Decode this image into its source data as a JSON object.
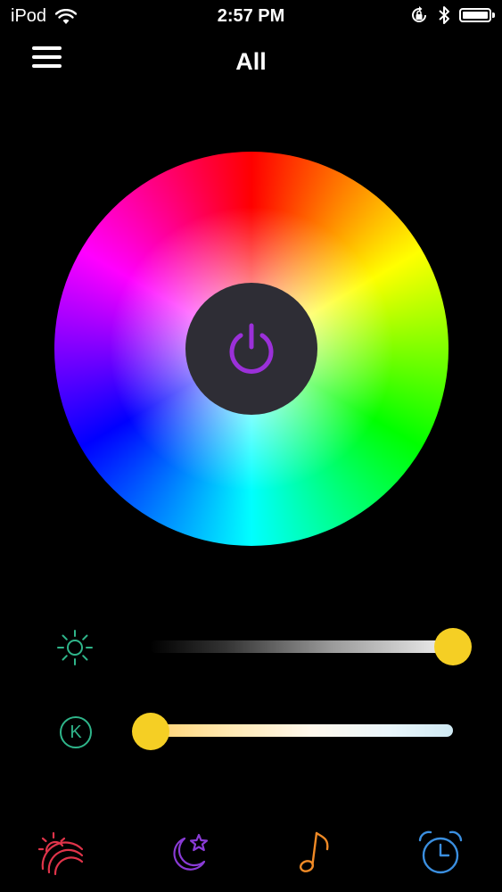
{
  "status_bar": {
    "carrier": "iPod",
    "time": "2:57 PM",
    "icons": [
      "wifi-icon",
      "rotation-lock-icon",
      "bluetooth-icon",
      "battery-icon"
    ]
  },
  "header": {
    "title": "All",
    "menu_icon": "hamburger-menu-icon"
  },
  "color_wheel": {
    "power_icon": "power-icon",
    "power_color": "#9b30d9",
    "button_bg": "#2e2d35"
  },
  "sliders": {
    "brightness": {
      "icon": "sun-icon",
      "icon_color": "#2fb58a",
      "value_percent": 100
    },
    "color_temperature": {
      "icon_text": "K",
      "icon_color": "#2fb58a",
      "value_percent": 0
    },
    "thumb_color": "#f5cf24"
  },
  "tab_bar": {
    "items": [
      {
        "icon": "sunrise-rainbow-icon",
        "color": "#e0344a"
      },
      {
        "icon": "moon-star-icon",
        "color": "#8a3bd6"
      },
      {
        "icon": "music-note-icon",
        "color": "#f08a26"
      },
      {
        "icon": "alarm-clock-icon",
        "color": "#3b8fe0"
      }
    ]
  }
}
